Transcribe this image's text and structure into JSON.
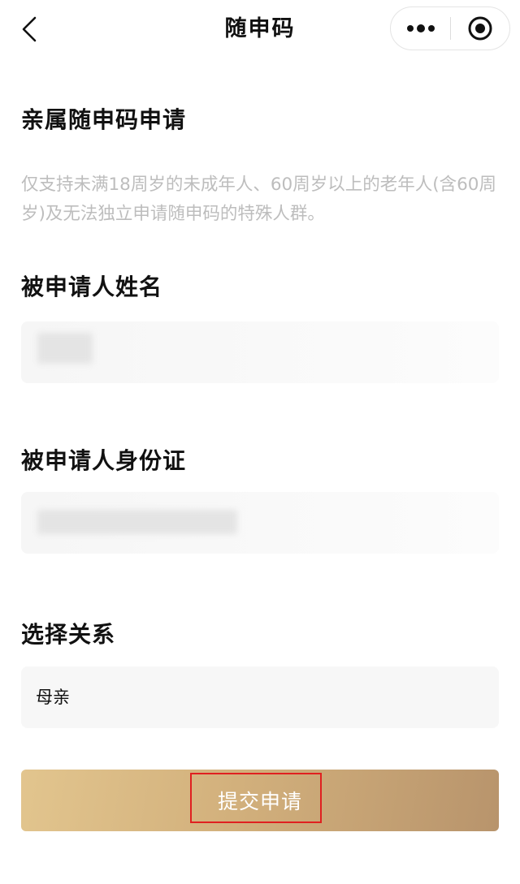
{
  "navbar": {
    "title": "随申码",
    "back_icon": "chevron-left-icon",
    "more_icon": "more-dots-icon",
    "close_icon": "target-circle-icon"
  },
  "form": {
    "heading": "亲属随申码申请",
    "description": "仅支持未满18周岁的未成年人、60周岁以上的老年人(含60周岁)及无法独立申请随申码的特殊人群。",
    "name_label": "被申请人姓名",
    "name_value": "",
    "id_label": "被申请人身份证",
    "id_value": "",
    "relation_label": "选择关系",
    "relation_value": "母亲"
  },
  "submit": {
    "label": "提交申请"
  },
  "colors": {
    "button_gradient_start": "#e2c58e",
    "button_gradient_end": "#b8946c",
    "highlight": "#e02020",
    "description_text": "#bdbdbd"
  }
}
